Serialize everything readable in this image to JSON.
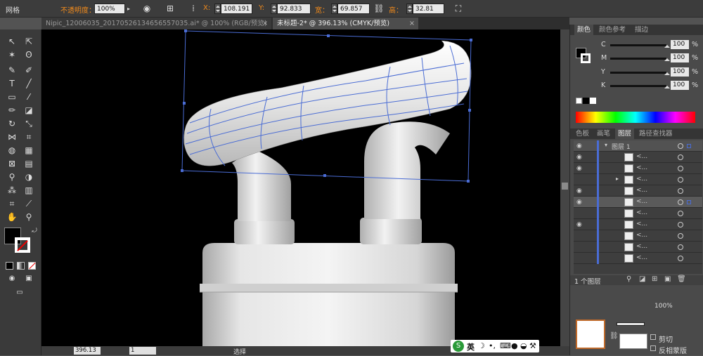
{
  "control_bar": {
    "panel_name": "网格",
    "opacity_label": "不透明度：",
    "opacity_value": "100%",
    "x_label": "X:",
    "x_value": "108.191 ",
    "y_label": "Y:",
    "y_value": "92.833 mm",
    "width_label": "宽：",
    "width_value": "69.857 mm",
    "height_label": "高：",
    "height_value": "32.81 mm"
  },
  "document_tabs": [
    {
      "label": "Nipic_12006035_20170526134656557035.ai* @ 100% (RGB/预览)",
      "close": "×",
      "active": false
    },
    {
      "label": "未标题-2* @ 396.13% (CMYK/预览)",
      "close": "×",
      "active": true
    }
  ],
  "color_panel": {
    "tabs": [
      "颜色",
      "颜色参考",
      "描边"
    ],
    "channels": [
      {
        "key": "C",
        "value": "100"
      },
      {
        "key": "M",
        "value": "100"
      },
      {
        "key": "Y",
        "value": "100"
      },
      {
        "key": "K",
        "value": "100"
      }
    ],
    "percent": "%"
  },
  "layers_panel": {
    "tabs": [
      "色板",
      "画笔",
      "图层",
      "路径查找器"
    ],
    "top_layer_name": "图层 1",
    "sublayer_name": "<...",
    "footer": "1 个图层"
  },
  "bottom_panel": {
    "opacity": "100%",
    "clip_label": "剪切",
    "invert_mask_label": "反相蒙版"
  },
  "status_bar": {
    "zoom_value": "396.13",
    "page_value": "1",
    "tool_label": "选择"
  },
  "ime_toolbar": {
    "lang": "英"
  },
  "colors": {
    "selection_blue": "#4a6cd4",
    "label_orange": "#f08a1c",
    "canvas_bg": "#000000"
  }
}
